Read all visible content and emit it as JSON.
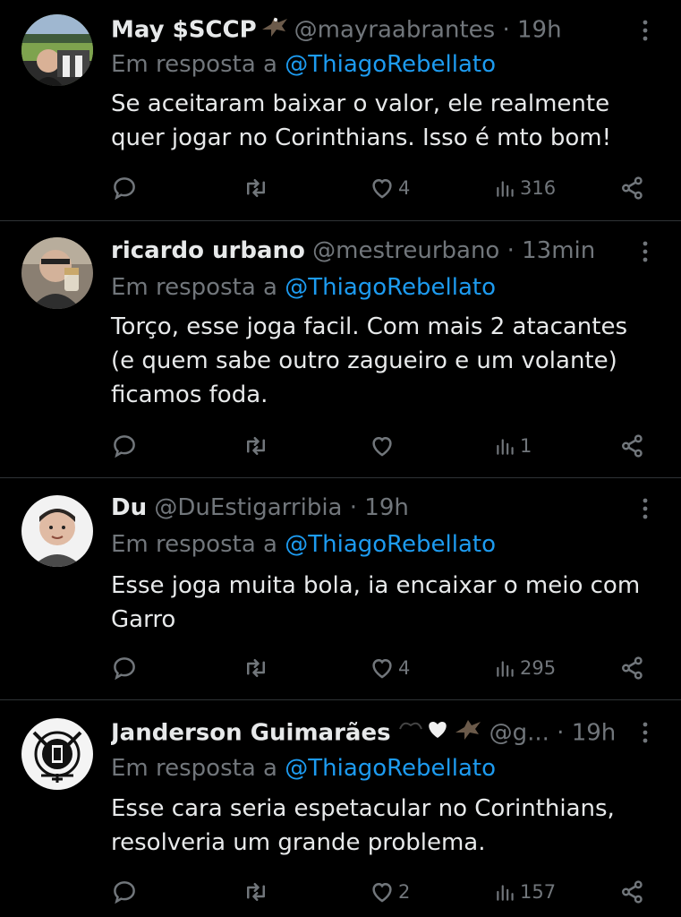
{
  "theme": {
    "background": "#000000",
    "text_primary": "#e7e9ea",
    "text_secondary": "#71767b",
    "link": "#1d9bf0",
    "divider": "#2f3336"
  },
  "reply_prefix": "Em resposta a",
  "tweets": [
    {
      "display_name": "May $SCCP",
      "badge": "eagle-emoji",
      "handle": "@mayraabrantes",
      "separator": "·",
      "time": "19h",
      "reply_to": "@ThiagoRebellato",
      "text": "Se aceitaram baixar o valor, ele realmente\nquer jogar no Corinthians. Isso é mto bom!",
      "likes": "4",
      "views": "316"
    },
    {
      "display_name": "ricardo urbano",
      "badge": "",
      "handle": "@mestreurbano",
      "separator": "·",
      "time": "13min",
      "reply_to": "@ThiagoRebellato",
      "text": "Torço, esse joga facil.  Com mais 2 atacantes\n(e quem sabe outro zagueiro e um volante)\nficamos foda.",
      "likes": "",
      "views": "1"
    },
    {
      "display_name": "Du",
      "badge": "",
      "handle": "@DuEstigarribia",
      "separator": "·",
      "time": "19h",
      "reply_to": "@ThiagoRebellato",
      "text": "Esse joga muita bola, ia encaixar o meio com\nGarro",
      "likes": "4",
      "views": "295"
    },
    {
      "display_name": "Janderson Guimarães",
      "badge": "hearts-eagle-emoji",
      "handle": "@g...",
      "separator": "·",
      "time": "19h",
      "reply_to": "@ThiagoRebellato",
      "text": "Esse cara seria espetacular no Corinthians,\nresolveria um grande problema.",
      "likes": "2",
      "views": "157"
    }
  ],
  "icons": {
    "reply": "reply-icon",
    "retweet": "retweet-icon",
    "like": "heart-icon",
    "views": "views-icon",
    "share": "share-icon",
    "more": "more-icon"
  }
}
